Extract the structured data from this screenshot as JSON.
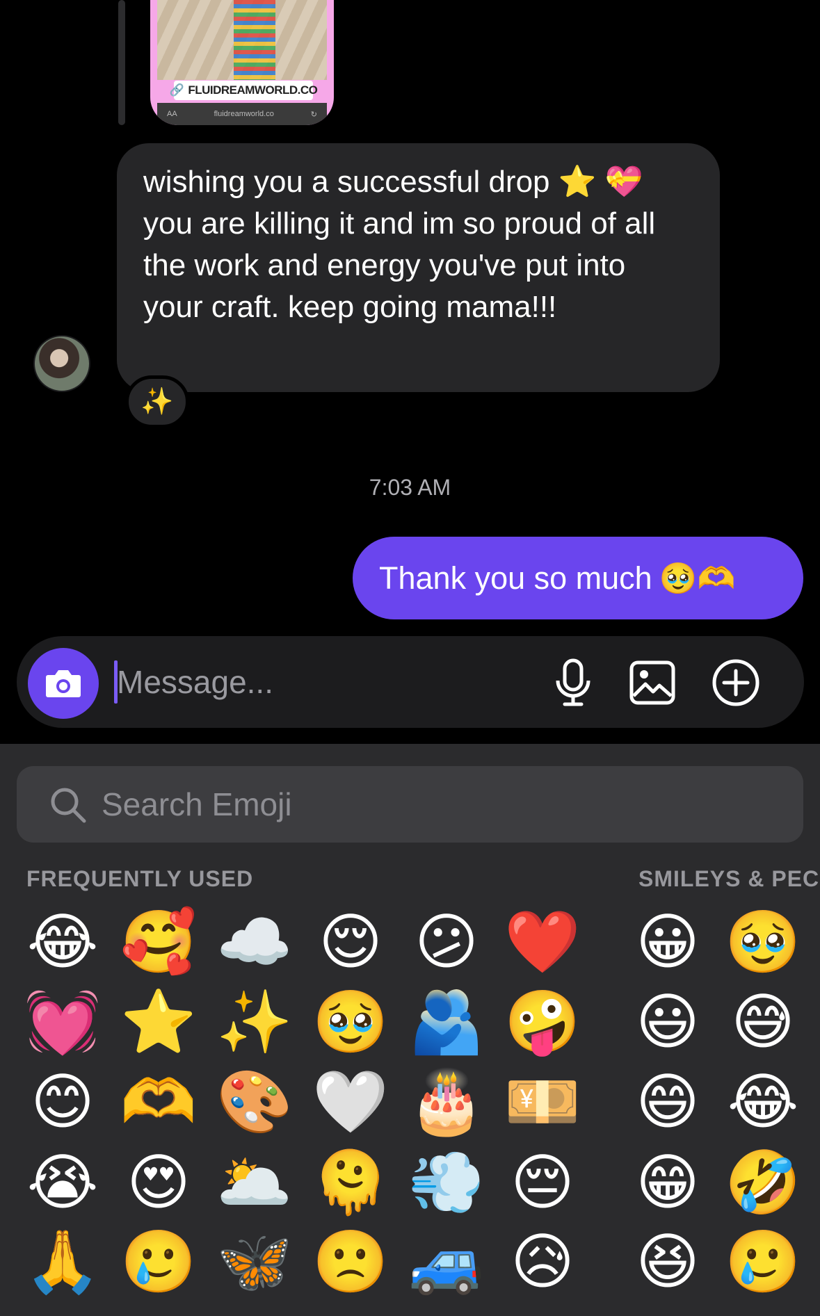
{
  "link_preview": {
    "tag": "FLUIDREAMWORLD.CO",
    "bar_left": "AA",
    "bar_url": "fluidreamworld.co",
    "bar_right": "↻"
  },
  "received": {
    "text": "wishing you a successful drop ⭐ 💝 you are killing it and im so proud of all the work and energy you've put into your craft. keep going mama!!!",
    "reaction": "✨"
  },
  "timestamp": "7:03 AM",
  "sent": {
    "text": "Thank you so much",
    "emojis": "🥹🫶"
  },
  "composer": {
    "placeholder": "Message..."
  },
  "emoji_keyboard": {
    "search_placeholder": "Search Emoji",
    "sections": {
      "frequently_used": "FREQUENTLY USED",
      "smileys": "SMILEYS & PEC"
    },
    "frequently_used": [
      "😂",
      "🥰",
      "☁️",
      "😌",
      "😕",
      "❤️",
      "💓",
      "⭐",
      "✨",
      "🥹",
      "🫂",
      "🤪",
      "😊",
      "🫶",
      "🎨",
      "🤍",
      "🎂",
      "💴",
      "😭",
      "😍",
      "🌥️",
      "🫠",
      "💨",
      "😔",
      "🙏",
      "🥲",
      "🦋",
      "🙁",
      "🚙",
      "😥"
    ],
    "smileys": [
      "😀",
      "🥹",
      "😃",
      "😅",
      "😄",
      "😂",
      "😁",
      "🤣",
      "😆",
      "🥲"
    ]
  }
}
